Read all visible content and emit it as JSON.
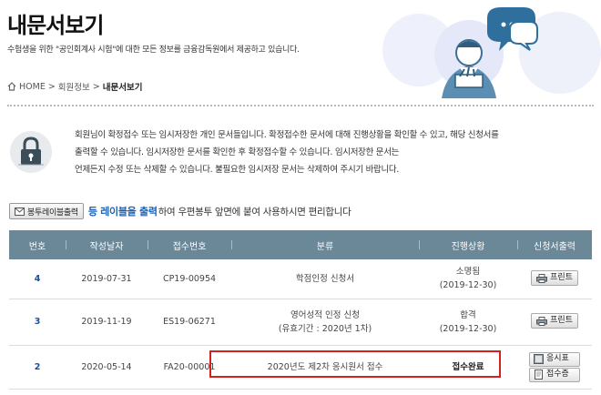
{
  "header": {
    "title": "내문서보기",
    "description": "수험생을 위한 \"공인회계사 시험\"에 대한 모든 정보를 금융감독원에서 제공하고 있습니다."
  },
  "breadcrumb": {
    "home": "HOME",
    "sep1": ">",
    "section": "회원정보",
    "sep2": ">",
    "current": "내문서보기"
  },
  "notice": {
    "line1": "회원님이 확정접수 또는 임시저장한 개인 문서들입니다. 확정접수한 문서에 대해 진행상황을 확인할 수 있고, 해당 신청서를",
    "line2": "출력할 수 있습니다. 임시저장한 문서를 확인한 후 확정접수할 수 있습니다. 임시저장한 문서는",
    "line3": "언제든지 수정 또는 삭제할 수 있습니다. 불필요한 임시저장 문서는 삭제하여 주시기 바랍니다."
  },
  "label_bar": {
    "button": "봉투레이블출력",
    "highlight": "등 레이블을 출력",
    "rest": "하여 우편봉투 앞면에 붙여 사용하시면 편리합니다"
  },
  "table": {
    "headers": [
      "번호",
      "작성날자",
      "접수번호",
      "분류",
      "진행상황",
      "신청서출력"
    ],
    "rows": [
      {
        "no": "4",
        "date": "2019-07-31",
        "receipt": "CP19-00954",
        "category": "학점인정 신청서",
        "category2": "",
        "status": "소명됨",
        "status2": "(2019-12-30)",
        "print": "프린트"
      },
      {
        "no": "3",
        "date": "2019-11-19",
        "receipt": "ES19-06271",
        "category": "영어성적 인정 신청",
        "category2": "(유효기간 : 2020년 1차)",
        "status": "합격",
        "status2": "(2019-12-30)",
        "print": "프린트"
      },
      {
        "no": "2",
        "date": "2020-05-14",
        "receipt": "FA20-00001",
        "category": "2020년도 제2차 응시원서 접수",
        "category2": "",
        "status": "접수완료",
        "status2": "",
        "btn_app": "응시표",
        "btn_receipt": "접수증"
      }
    ]
  },
  "colors": {
    "header_bg": "#6a8898",
    "link_blue": "#1a4f9c",
    "highlight_red": "#d3211f"
  }
}
